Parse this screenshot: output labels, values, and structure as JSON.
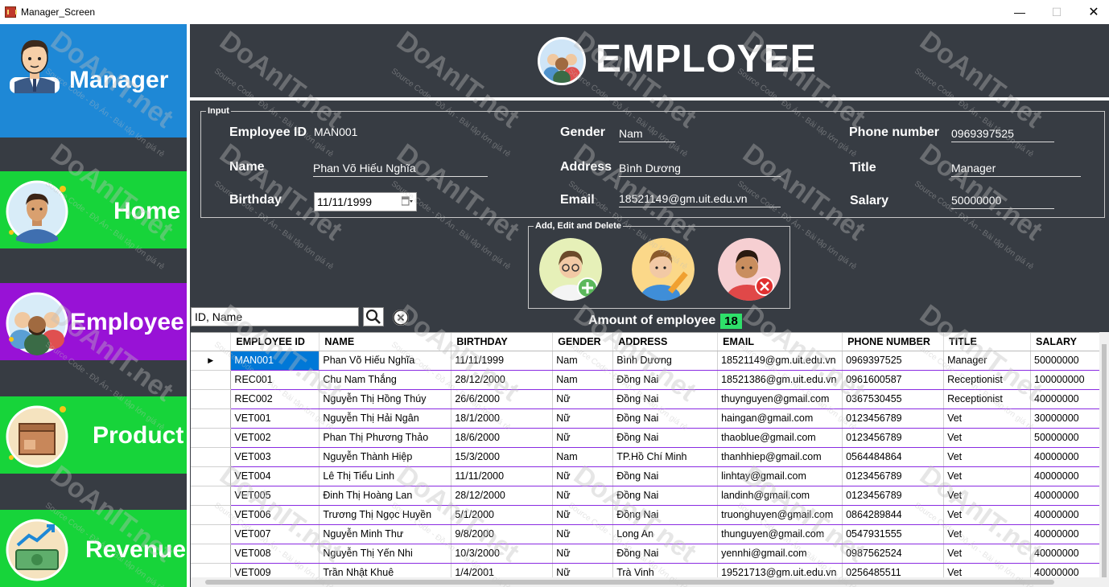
{
  "window": {
    "title": "Manager_Screen",
    "min": "—",
    "max": "☐",
    "close": "✕"
  },
  "sidebar": {
    "items": [
      {
        "label": "Manager"
      },
      {
        "label": "Home"
      },
      {
        "label": "Employee"
      },
      {
        "label": "Product"
      },
      {
        "label": "Revenue"
      }
    ]
  },
  "header": {
    "title": "EMPLOYEE"
  },
  "input_group": {
    "legend": "Input",
    "employee_id": {
      "label": "Employee ID",
      "value": "MAN001"
    },
    "name": {
      "label": "Name",
      "value": "Phan Võ Hiếu Nghĩa"
    },
    "birthday": {
      "label": "Birthday",
      "value": "11/11/1999"
    },
    "gender": {
      "label": "Gender",
      "value": "Nam"
    },
    "address": {
      "label": "Address",
      "value": "Bình Dương"
    },
    "email": {
      "label": "Email",
      "value": "18521149@gm.uit.edu.vn"
    },
    "phone": {
      "label": "Phone number",
      "value": "0969397525"
    },
    "title": {
      "label": "Title",
      "value": "Manager"
    },
    "salary": {
      "label": "Salary",
      "value": "50000000"
    }
  },
  "actions": {
    "legend": "Add, Edit and Delete"
  },
  "search": {
    "value": "ID, Name"
  },
  "amount": {
    "label": "Amount of employee",
    "value": "18"
  },
  "table": {
    "columns": [
      "EMPLOYEE ID",
      "NAME",
      "BIRTHDAY",
      "GENDER",
      "ADDRESS",
      "EMAIL",
      "PHONE NUMBER",
      "TITLE",
      "SALARY"
    ],
    "selected_row_marker": "▶",
    "rows": [
      [
        "MAN001",
        "Phan Võ Hiếu Nghĩa",
        "11/11/1999",
        "Nam",
        "Bình Dương",
        "18521149@gm.uit.edu.vn",
        "0969397525",
        "Manager",
        "50000000"
      ],
      [
        "REC001",
        "Chu Nam Thắng",
        "28/12/2000",
        "Nam",
        "Đồng Nai",
        "18521386@gm.uit.edu.vn",
        "0961600587",
        "Receptionist",
        "100000000"
      ],
      [
        "REC002",
        "Nguyễn Thị Hồng Thúy",
        "26/6/2000",
        "Nữ",
        "Đồng Nai",
        "thuynguyen@gmail.com",
        "0367530455",
        "Receptionist",
        "40000000"
      ],
      [
        "VET001",
        "Nguyễn Thị Hải Ngân",
        "18/1/2000",
        "Nữ",
        "Đồng Nai",
        "haingan@gmail.com",
        "0123456789",
        "Vet",
        "30000000"
      ],
      [
        "VET002",
        "Phan Thị Phương Thảo",
        "18/6/2000",
        "Nữ",
        "Đồng Nai",
        "thaoblue@gmail.com",
        "0123456789",
        "Vet",
        "50000000"
      ],
      [
        "VET003",
        "Nguyễn Thành Hiệp",
        "15/3/2000",
        "Nam",
        "TP.Hồ Chí Minh",
        "thanhhiep@gmail.com",
        "0564484864",
        "Vet",
        "40000000"
      ],
      [
        "VET004",
        "Lê Thị Tiểu Linh",
        "11/11/2000",
        "Nữ",
        "Đồng Nai",
        "linhtay@gmail.com",
        "0123456789",
        "Vet",
        "40000000"
      ],
      [
        "VET005",
        "Đinh Thị Hoàng Lan",
        "28/12/2000",
        "Nữ",
        "Đồng Nai",
        "landinh@gmail.com",
        "0123456789",
        "Vet",
        "40000000"
      ],
      [
        "VET006",
        "Trương Thị Ngọc Huyền",
        "5/1/2000",
        "Nữ",
        "Đồng Nai",
        "truonghuyen@gmail.com",
        "0864289844",
        "Vet",
        "40000000"
      ],
      [
        "VET007",
        "Nguyễn Minh Thư",
        "9/8/2000",
        "Nữ",
        "Long An",
        "thunguyen@gmail.com",
        "0547931555",
        "Vet",
        "40000000"
      ],
      [
        "VET008",
        "Nguyễn Thị Yến Nhi",
        "10/3/2000",
        "Nữ",
        "Đồng Nai",
        "yennhi@gmail.com",
        "0987562524",
        "Vet",
        "40000000"
      ],
      [
        "VET009",
        "Trần Nhật Khuê",
        "1/4/2001",
        "Nữ",
        "Trà Vinh",
        "19521713@gm.uit.edu.vn",
        "0256485511",
        "Vet",
        "40000000"
      ]
    ]
  },
  "watermark": {
    "text": "DoAnIT.net",
    "sub": "Source Code - Đồ Án - Bài tập lớn giá rẻ"
  }
}
